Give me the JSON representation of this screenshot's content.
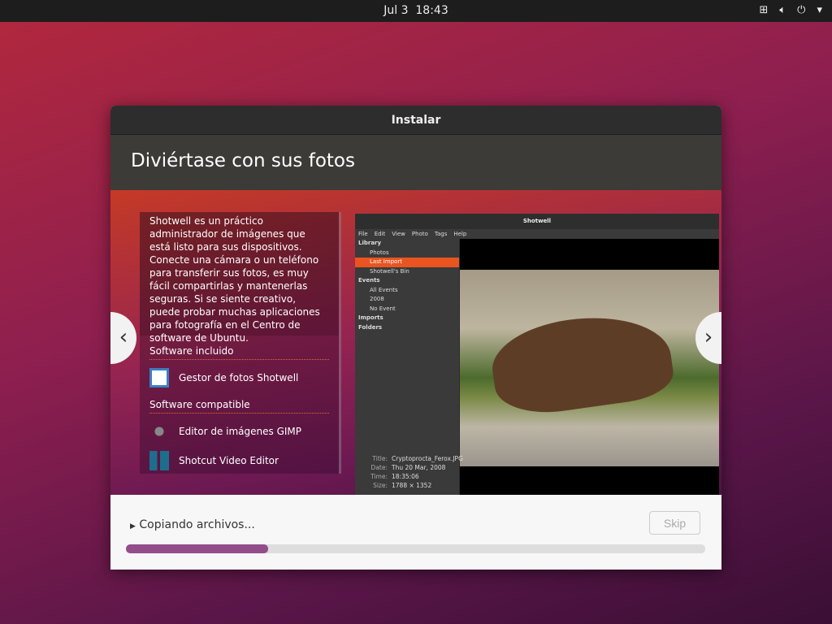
{
  "topbar": {
    "date": "Jul 3",
    "time": "18:43",
    "network_icon": "network-icon",
    "volume_icon": "volume-icon",
    "power_icon": "power-icon"
  },
  "dialog": {
    "title": "Instalar",
    "heading": "Diviértase con sus fotos"
  },
  "slide": {
    "description": "Shotwell es un práctico administrador de imágenes que está listo para sus dispositivos. Conecte una cámara o un teléfono para transferir sus fotos, es muy fácil compartirlas y mantenerlas seguras. Si se siente creativo, puede probar muchas aplicaciones para fotografía en el Centro de software de Ubuntu.",
    "included_label": "Software incluido",
    "included": [
      {
        "name": "Gestor de fotos Shotwell"
      }
    ],
    "compatible_label": "Software compatible",
    "compatible": [
      {
        "name": "Editor de imágenes GIMP"
      },
      {
        "name": "Shotcut Video Editor"
      }
    ],
    "prev": "‹",
    "next": "›"
  },
  "shotwell": {
    "title": "Shotwell",
    "menu": [
      "File",
      "Edit",
      "View",
      "Photo",
      "Tags",
      "Help"
    ],
    "sidebar": [
      "Library",
      "Photos",
      "Last Import",
      "Shotwell's Bin",
      "Events",
      "All Events",
      "2008",
      "No Event",
      "Imports",
      "Folders"
    ],
    "meta": {
      "title_label": "Title:",
      "title": "Cryptoprocta_Ferox.JPG",
      "date_label": "Date:",
      "date": "Thu 20 Mar, 2008",
      "time_label": "Time:",
      "time": "18:35:06",
      "size_label": "Size:",
      "size": "1788 × 1352"
    }
  },
  "progress": {
    "status": "Copiando archivos...",
    "skip": "Skip",
    "percent": 24.5,
    "color": "#924d8b"
  }
}
